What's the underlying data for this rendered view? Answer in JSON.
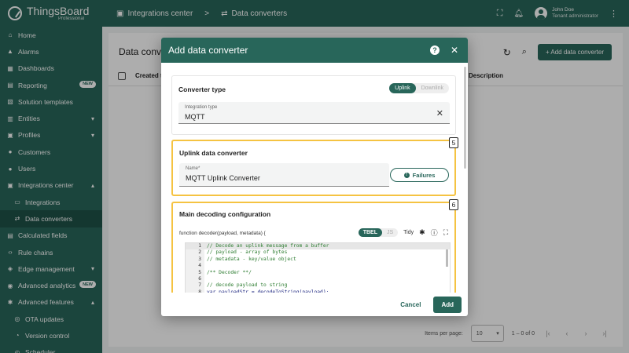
{
  "app": {
    "brand": "ThingsBoard",
    "edition": "Professional"
  },
  "sidebar": {
    "items": [
      {
        "label": "Home",
        "icon": "home-icon"
      },
      {
        "label": "Alarms",
        "icon": "bell-icon"
      },
      {
        "label": "Dashboards",
        "icon": "dashboard-icon"
      },
      {
        "label": "Reporting",
        "icon": "report-icon",
        "badge": "NEW"
      },
      {
        "label": "Solution templates",
        "icon": "template-icon"
      },
      {
        "label": "Entities",
        "icon": "entities-icon"
      },
      {
        "label": "Profiles",
        "icon": "profiles-icon"
      },
      {
        "label": "Customers",
        "icon": "customers-icon"
      },
      {
        "label": "Users",
        "icon": "users-icon"
      },
      {
        "label": "Integrations center",
        "icon": "integrations-center-icon"
      },
      {
        "label": "Integrations",
        "icon": "integrations-icon"
      },
      {
        "label": "Data converters",
        "icon": "converter-icon"
      },
      {
        "label": "Calculated fields",
        "icon": "calculated-icon"
      },
      {
        "label": "Rule chains",
        "icon": "rule-chain-icon"
      },
      {
        "label": "Edge management",
        "icon": "edge-icon"
      },
      {
        "label": "Advanced analytics",
        "icon": "analytics-icon",
        "badge": "NEW"
      },
      {
        "label": "Advanced features",
        "icon": "features-icon"
      },
      {
        "label": "OTA updates",
        "icon": "ota-icon"
      },
      {
        "label": "Version control",
        "icon": "version-icon"
      },
      {
        "label": "Scheduler",
        "icon": "scheduler-icon"
      }
    ]
  },
  "topbar": {
    "breadcrumb": [
      "Integrations center",
      "Data converters"
    ],
    "separator": ">",
    "user_name": "John Doe",
    "user_role": "Tenant administrator"
  },
  "page": {
    "title": "Data conve",
    "add_label": "+ Add data converter",
    "columns": {
      "created": "Created ti",
      "description": "Description"
    },
    "pager": {
      "items_label": "Items per page:",
      "page_size": "10",
      "range": "1 – 0 of 0"
    }
  },
  "dialog": {
    "title": "Add data converter",
    "converter_type": {
      "title": "Converter type",
      "options": [
        "Uplink",
        "Downlink"
      ],
      "selected": "Uplink",
      "field_label": "Integration type",
      "field_value": "MQTT"
    },
    "uplink": {
      "title": "Uplink data converter",
      "name_label": "Name*",
      "name_value": "MQTT Uplink Converter",
      "failures_label": "Failures",
      "marker": "5"
    },
    "decoding": {
      "title": "Main decoding configuration",
      "signature": "function decoder(payload, metadata) {",
      "langs": [
        "TBEL",
        "JS"
      ],
      "selected_lang": "TBEL",
      "tidy_label": "Tidy",
      "marker": "6",
      "code_lines": [
        {
          "n": "1",
          "text": "// Decode an uplink message from a buffer",
          "kind": "comment"
        },
        {
          "n": "2",
          "text": "// payload - array of bytes",
          "kind": "comment"
        },
        {
          "n": "3",
          "text": "// metadata - key/value object",
          "kind": "comment"
        },
        {
          "n": "4",
          "text": "",
          "kind": "plain"
        },
        {
          "n": "5",
          "text": "/** Decoder **/",
          "kind": "comment"
        },
        {
          "n": "6",
          "text": "",
          "kind": "plain"
        },
        {
          "n": "7",
          "text": "// decode payload to string",
          "kind": "comment"
        },
        {
          "n": "8",
          "text": "var payloadStr = decodeToString(payload);",
          "kind": "kw"
        }
      ]
    },
    "cancel_label": "Cancel",
    "add_label": "Add"
  }
}
